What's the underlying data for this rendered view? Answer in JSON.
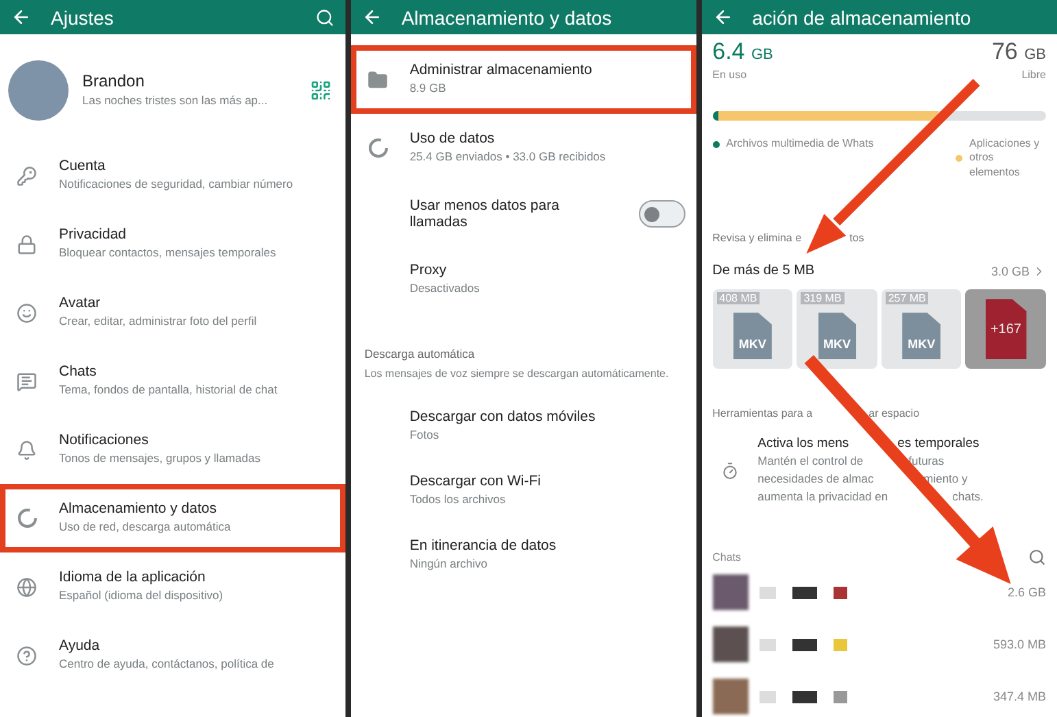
{
  "settings": {
    "title": "Ajustes",
    "profile": {
      "name": "Brandon",
      "status": "Las noches tristes son las más ap..."
    },
    "items": [
      {
        "title": "Cuenta",
        "subtitle": "Notificaciones de seguridad, cambiar número",
        "highlighted": false
      },
      {
        "title": "Privacidad",
        "subtitle": "Bloquear contactos, mensajes temporales",
        "highlighted": false
      },
      {
        "title": "Avatar",
        "subtitle": "Crear, editar, administrar foto del perfil",
        "highlighted": false
      },
      {
        "title": "Chats",
        "subtitle": "Tema, fondos de pantalla, historial de chat",
        "highlighted": false
      },
      {
        "title": "Notificaciones",
        "subtitle": "Tonos de mensajes, grupos y llamadas",
        "highlighted": false
      },
      {
        "title": "Almacenamiento y datos",
        "subtitle": "Uso de red, descarga automática",
        "highlighted": true
      },
      {
        "title": "Idioma de la aplicación",
        "subtitle": "Español (idioma del dispositivo)",
        "highlighted": false
      },
      {
        "title": "Ayuda",
        "subtitle": "Centro de ayuda, contáctanos, política de",
        "highlighted": false
      }
    ]
  },
  "storage_settings": {
    "title": "Almacenamiento y datos",
    "items": [
      {
        "kind": "item",
        "title": "Administrar almacenamiento",
        "subtitle": "8.9 GB",
        "highlighted": true
      },
      {
        "kind": "item",
        "title": "Uso de datos",
        "subtitle": "25.4 GB enviados • 33.0 GB recibidos",
        "highlighted": false
      },
      {
        "kind": "toggle",
        "title": "Usar menos datos para llamadas",
        "on": false
      },
      {
        "kind": "item",
        "title": "Proxy",
        "subtitle": "Desactivados",
        "highlighted": false
      }
    ],
    "section": {
      "title": "Descarga automática",
      "note": "Los mensajes de voz siempre se descargan automáticamente."
    },
    "download_items": [
      {
        "title": "Descargar con datos móviles",
        "subtitle": "Fotos"
      },
      {
        "title": "Descargar con Wi-Fi",
        "subtitle": "Todos los archivos"
      },
      {
        "title": "En itinerancia de datos",
        "subtitle": "Ningún archivo"
      }
    ]
  },
  "manage_storage": {
    "title": "ación de almacenamiento",
    "used": {
      "value": "6.4",
      "unit": "GB",
      "label": "En uso"
    },
    "free": {
      "value": "76",
      "unit": "GB",
      "label": "Libre"
    },
    "bar": [
      {
        "color": "#0b7a5e",
        "level": 0.01
      },
      {
        "color": "#f5c66b",
        "level": 0.66
      }
    ],
    "legend": [
      {
        "color": "#0b7a5e",
        "label": "Archivos multimedia de Whats"
      },
      {
        "color": "#f5c66b",
        "label": "Aplicaciones y otros elementos"
      }
    ],
    "review_parts": [
      "Revisa y elimina e",
      "tos"
    ],
    "large_files": {
      "title": "De más de 5 MB",
      "size": "3.0 GB",
      "files": [
        {
          "kind": "file",
          "size": "408 MB",
          "type": "MKV"
        },
        {
          "kind": "file",
          "size": "319 MB",
          "type": "MKV"
        },
        {
          "kind": "file",
          "size": "257 MB",
          "type": "MKV"
        },
        {
          "kind": "more",
          "count": "+167"
        }
      ]
    },
    "tools_parts": [
      "Herramientas para a",
      "ar espacio"
    ],
    "tool": {
      "title_parts": [
        "Activa los mens",
        "es temporales"
      ],
      "description_lines": [
        [
          "Mantén el control de",
          "futuras"
        ],
        [
          "necesidades de almac",
          "miento y"
        ],
        [
          "aumenta la privacidad en",
          "chats."
        ]
      ]
    },
    "chats_title": "Chats",
    "chats": [
      {
        "size": "2.6 GB"
      },
      {
        "size": "593.0 MB"
      },
      {
        "size": "347.4 MB"
      }
    ]
  }
}
